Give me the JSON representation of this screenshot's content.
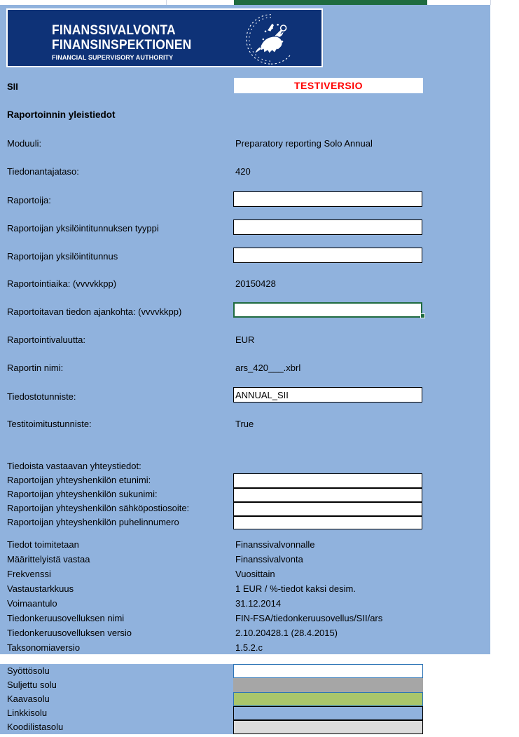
{
  "app": {
    "sheet_name": "SII",
    "test_banner": "TESTIVERSIO",
    "logo": {
      "line1": "FINANSSIVALVONTA",
      "line2": "FINANSINSPEKTIONEN",
      "line3": "FINANCIAL SUPERVISORY AUTHORITY",
      "crest_icon": "finnish-lion-crest-icon",
      "bg_color": "#0e3277"
    },
    "colors": {
      "sheet_bg": "#90b2dd",
      "selection_green": "#1f6b3f",
      "test_red": "#ff0000",
      "formula_green": "#a9c66b",
      "locked_gray": "#a6a6a6",
      "codelist_gray": "#dcdcdc",
      "link_blue": "#90b2dd"
    }
  },
  "section": {
    "title": "Raportoinnin yleistiedot"
  },
  "fields": [
    {
      "label": "Moduuli:",
      "value": "Preparatory reporting Solo Annual",
      "kind": "text"
    },
    {
      "label": "Tiedonantajataso:",
      "value": "420",
      "kind": "text"
    },
    {
      "label": "Raportoija:",
      "value": "",
      "kind": "input"
    },
    {
      "label": "Raportoijan yksilöintitunnuksen tyyppi",
      "value": "",
      "kind": "input"
    },
    {
      "label": "Raportoijan yksilöintitunnus",
      "value": "",
      "kind": "input"
    },
    {
      "label": "Raportointiaika: (vvvvkkpp)",
      "value": "20150428",
      "kind": "text"
    },
    {
      "label": "Raportoitavan tiedon ajankohta: (vvvvkkpp)",
      "value": "",
      "kind": "input-selected"
    },
    {
      "label": "Raportointivaluutta:",
      "value": "EUR",
      "kind": "text"
    },
    {
      "label": "Raportin nimi:",
      "value": "ars_420___.xbrl",
      "kind": "text"
    },
    {
      "label": "Tiedostotunniste:",
      "value": "ANNUAL_SII",
      "kind": "input"
    },
    {
      "label": "Testitoimitustunniste:",
      "value": "True",
      "kind": "text"
    }
  ],
  "contact": {
    "heading": "Tiedoista vastaavan yhteystiedot:",
    "rows": [
      {
        "label": "Raportoijan yhteyshenkilön etunimi:",
        "value": ""
      },
      {
        "label": "Raportoijan yhteyshenkilön sukunimi:",
        "value": ""
      },
      {
        "label": "Raportoijan yhteyshenkilön sähköpostiosoite:",
        "value": ""
      },
      {
        "label": "Raportoijan yhteyshenkilön puhelinnumero",
        "value": ""
      }
    ]
  },
  "meta": [
    {
      "label": "Tiedot toimitetaan",
      "value": "Finanssivalvonnalle"
    },
    {
      "label": "Määrittelyistä vastaa",
      "value": "Finanssivalvonta"
    },
    {
      "label": "Frekvenssi",
      "value": "Vuosittain"
    },
    {
      "label": "Vastaustarkkuus",
      "value": "1 EUR / %-tiedot kaksi desim."
    },
    {
      "label": "Voimaantulo",
      "value": "31.12.2014"
    },
    {
      "label": "Tiedonkeruusovelluksen nimi",
      "value": "FIN-FSA/tiedonkeruusovellus/SII/ars"
    },
    {
      "label": "Tiedonkeruusovelluksen versio",
      "value": "2.10.20428.1 (28.4.2015)"
    },
    {
      "label": "Taksonomiaversio",
      "value": "1.5.2.c"
    }
  ],
  "legend": [
    {
      "label": "Syöttösolu",
      "fill": "#ffffff",
      "border": "#2e75b6"
    },
    {
      "label": "Suljettu solu",
      "fill": "#a6a6a6",
      "border": "#a6a6a6"
    },
    {
      "label": "Kaavasolu",
      "fill": "#a9c66b",
      "border": "#2e75b6"
    },
    {
      "label": "Linkkisolu",
      "fill": "#90b2dd",
      "border": "#000000"
    },
    {
      "label": "Koodilistasolu",
      "fill": "#dcdcdc",
      "border": "#000000"
    }
  ]
}
